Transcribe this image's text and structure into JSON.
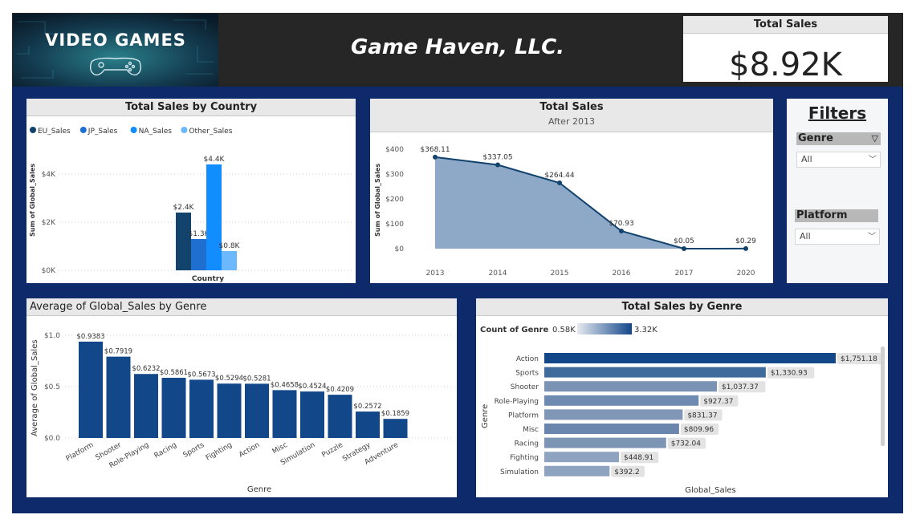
{
  "header": {
    "logo_text": "VIDEO GAMES",
    "company": "Game Haven, LLC."
  },
  "kpi": {
    "title": "Total Sales",
    "value": "$8.92K"
  },
  "filters": {
    "title": "Filters",
    "genre_label": "Genre",
    "genre_value": "All",
    "platform_label": "Platform",
    "platform_value": "All"
  },
  "chart_data": [
    {
      "type": "bar",
      "title": "Total Sales by Country",
      "xlabel": "Country",
      "ylabel": "Sum of Global_Sales",
      "ylim": [
        0,
        4400
      ],
      "yticks": [
        "$0K",
        "$2K",
        "$4K"
      ],
      "legend_position": "top-left",
      "series": [
        {
          "name": "EU_Sales",
          "value": 2.4,
          "label": "$2.4K",
          "color": "#12436d"
        },
        {
          "name": "JP_Sales",
          "value": 1.3,
          "label": "$1.3K",
          "color": "#1f6fd1"
        },
        {
          "name": "NA_Sales",
          "value": 4.4,
          "label": "$4.4K",
          "color": "#118dff"
        },
        {
          "name": "Other_Sales",
          "value": 0.8,
          "label": "$0.8K",
          "color": "#6cb8ff"
        }
      ]
    },
    {
      "type": "area",
      "title": "Total Sales",
      "subtitle": "After 2013",
      "ylabel": "Sum of Global_Sales",
      "ylim": [
        0,
        400
      ],
      "yticks": [
        "$0",
        "$100",
        "$200",
        "$300",
        "$400"
      ],
      "x": [
        "2013",
        "2014",
        "2015",
        "2016",
        "2017",
        "2020"
      ],
      "values": [
        368.11,
        337.05,
        264.44,
        70.93,
        0.05,
        0.29
      ],
      "labels": [
        "$368.11",
        "$337.05",
        "$264.44",
        "$70.93",
        "$0.05",
        "$0.29"
      ],
      "color": "#12436d",
      "fill": "#8ea9c8"
    },
    {
      "type": "bar",
      "title": "Average of Global_Sales by Genre",
      "xlabel": "Genre",
      "ylabel": "Average of Global_Sales",
      "ylim": [
        0,
        1.0
      ],
      "yticks": [
        "$0.0",
        "$0.5",
        "$1.0"
      ],
      "categories": [
        "Platform",
        "Shooter",
        "Role-Playing",
        "Racing",
        "Sports",
        "Fighting",
        "Action",
        "Misc",
        "Simulation",
        "Puzzle",
        "Strategy",
        "Adventure"
      ],
      "values": [
        0.9383,
        0.7919,
        0.6232,
        0.5861,
        0.5673,
        0.5294,
        0.5281,
        0.4658,
        0.4524,
        0.4209,
        0.2572,
        0.1859
      ],
      "labels": [
        "$0.9383",
        "$0.7919",
        "$0.6232",
        "$0.5861",
        "$0.5673",
        "$0.5294",
        "$0.5281",
        "$0.4658",
        "$0.4524",
        "$0.4209",
        "$0.2572",
        "$0.1859"
      ],
      "color": "#12478a"
    },
    {
      "type": "bar",
      "orientation": "horizontal",
      "title": "Total Sales by Genre",
      "xlabel": "Global_Sales",
      "ylabel": "Genre",
      "color_legend_title": "Count of Genre",
      "color_legend_min": "0.58K",
      "color_legend_max": "3.32K",
      "categories": [
        "Action",
        "Sports",
        "Shooter",
        "Role-Playing",
        "Platform",
        "Misc",
        "Racing",
        "Fighting",
        "Simulation"
      ],
      "values": [
        1751.18,
        1330.93,
        1037.37,
        927.37,
        831.37,
        809.96,
        732.04,
        448.91,
        392.2
      ],
      "labels": [
        "$1,751.18",
        "$1,330.93",
        "$1,037.37",
        "$927.37",
        "$831.37",
        "$809.96",
        "$732.04",
        "$448.91",
        "$392.2"
      ],
      "colors": [
        "#12478a",
        "#3f6b9c",
        "#7a93b4",
        "#6f8ab0",
        "#7f96b6",
        "#6a86ad",
        "#7d95b5",
        "#8ea3bf",
        "#8ea3bf"
      ]
    }
  ]
}
